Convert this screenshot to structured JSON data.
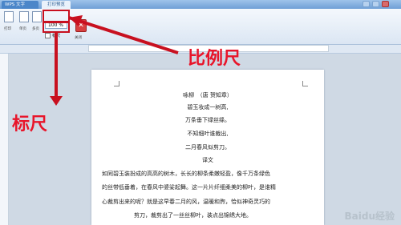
{
  "titlebar": {
    "app_tab": "WPS 文字",
    "doc_tab": "打印预览"
  },
  "ribbon": {
    "print_label": "打印",
    "single_page_label": "单页",
    "multi_page_label": "多页",
    "zoom_value": "100 %",
    "ruler_label": "标尺",
    "close_label": "关闭"
  },
  "document": {
    "title": "咏柳　（唐 贺知章）",
    "poem": [
      "碧玉妆成一树高,",
      "万条垂下绿丝绦。",
      "不知细叶谁裁出,",
      "二月春风似剪刀。"
    ],
    "translation_heading": "译文",
    "translation": [
      "如同碧玉装扮成的高高的树木，长长的柳条柔嫩轻盈，像千万条绿色",
      "的丝带低垂着，在春风中婆娑起舞。这一片片纤细柔美的柳叶，是谁精",
      "心裁剪出来的呢？就是这早春二月的风，温暖和煦，恰似神奇灵巧的",
      "剪刀，裁剪出了一丝丝柳叶，装点出锦绣大地。"
    ]
  },
  "annotations": {
    "ratio_ruler": "比例尺",
    "ruler": "标尺",
    "arrow_color": "#c8101f"
  },
  "watermark": "Baidu经验"
}
